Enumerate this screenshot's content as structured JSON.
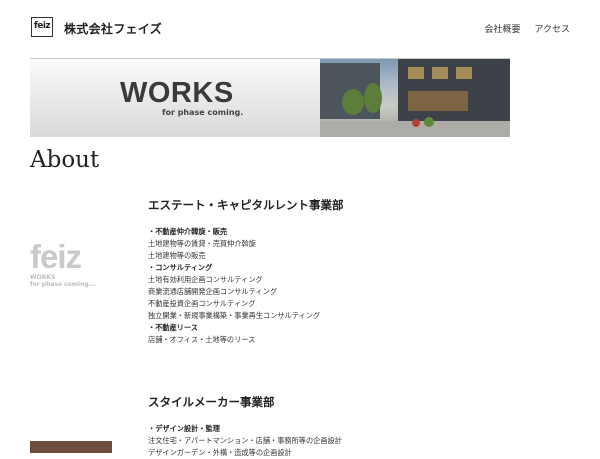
{
  "header": {
    "logo_text": "feiz",
    "brand": "株式会社フェイズ",
    "nav": [
      "会社概要",
      "アクセス"
    ]
  },
  "banner": {
    "title": "WORKS",
    "subtitle": "for phase coming."
  },
  "page_title": "About",
  "section_logo": {
    "text": "feiz",
    "sub1": "WORKS",
    "sub2": "for phase coming..."
  },
  "sections": [
    {
      "title": "エステート・キャピタルレント事業部",
      "items": [
        {
          "text": "・不動産仲介韓旋・販売",
          "head": true
        },
        {
          "text": "土地建物等の賃貸・売買仲介斡旋",
          "head": false
        },
        {
          "text": "土地建物等の販売",
          "head": false
        },
        {
          "text": "・コンサルティング",
          "head": true
        },
        {
          "text": "土地有効利用企画コンサルティング",
          "head": false
        },
        {
          "text": "商業流通店舗開発企画コンサルティング",
          "head": false
        },
        {
          "text": "不動産投資企画コンサルティング",
          "head": false
        },
        {
          "text": "独立開業・新規事業構築・事業再生コンサルティング",
          "head": false
        },
        {
          "text": "・不動産リース",
          "head": true
        },
        {
          "text": "店舗・オフィス・土地等のリース",
          "head": false
        }
      ]
    },
    {
      "title": "スタイルメーカー事業部",
      "items": [
        {
          "text": "・デザイン設計・監理",
          "head": true
        },
        {
          "text": "注文住宅・アパートマンション・店舗・事務所等の企画設計",
          "head": false
        },
        {
          "text": "デザインガーデン・外構・造成等の企画設計",
          "head": false
        }
      ]
    }
  ]
}
